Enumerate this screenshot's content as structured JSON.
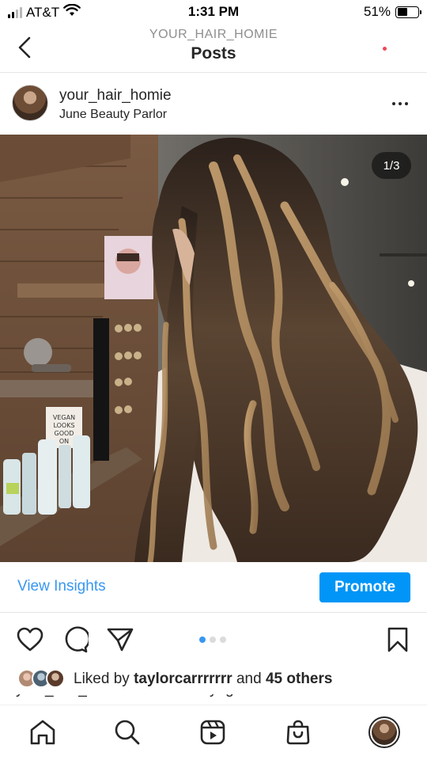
{
  "status_bar": {
    "carrier": "AT&T",
    "time": "1:31 PM",
    "battery_percent": "51%",
    "battery_level": 0.51,
    "signal_bars": 2,
    "icons": [
      "signal-icon",
      "wifi-icon",
      "battery-icon"
    ]
  },
  "nav": {
    "account": "YOUR_HAIR_HOMIE",
    "title": "Posts",
    "back_icon": "chevron-left-icon"
  },
  "post": {
    "username": "your_hair_homie",
    "location": "June Beauty Parlor",
    "more_icon": "more-horizontal-icon",
    "image_counter": "1/3",
    "image_alt": "photo",
    "carousel": {
      "count": 3,
      "active": 0
    }
  },
  "insights": {
    "view_label": "View Insights",
    "promote_label": "Promote"
  },
  "actions": {
    "icons": [
      "heart-icon",
      "comment-icon",
      "share-icon",
      "bookmark-icon"
    ]
  },
  "likes": {
    "prefix": "Liked by",
    "user": "taylorcarrrrrrr",
    "and": "and",
    "others": "45 others"
  },
  "caption_peek": "your_hair_homie Mocha balayage on VIRGIN hair",
  "tab_bar": {
    "icons": [
      "home-icon",
      "search-icon",
      "reels-icon",
      "shop-icon",
      "profile-icon"
    ]
  },
  "colors": {
    "link_blue": "#3897f0",
    "promote_blue": "#0095f6",
    "text": "#262626",
    "notification_red": "#ed4956"
  }
}
